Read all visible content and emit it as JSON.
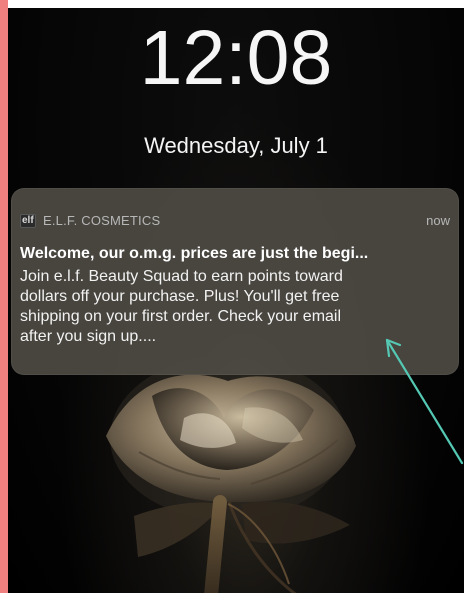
{
  "lockscreen": {
    "time": "12:08",
    "date": "Wednesday, July 1"
  },
  "notification": {
    "app_icon_text": "elf",
    "app_name": "E.L.F. COSMETICS",
    "time": "now",
    "title": "Welcome, our o.m.g. prices are just the begi...",
    "body_lines": [
      "Join e.l.f. Beauty Squad to earn points toward",
      "dollars off your purchase. Plus! You'll get free",
      "shipping on your first order. Check your email",
      "after you sign up...."
    ]
  },
  "colors": {
    "left_strip": "#f07f7f",
    "arrow": "#54c8b3"
  },
  "icons": {
    "app_icon": "elf-logo-icon",
    "annotation": "arrow-icon"
  }
}
